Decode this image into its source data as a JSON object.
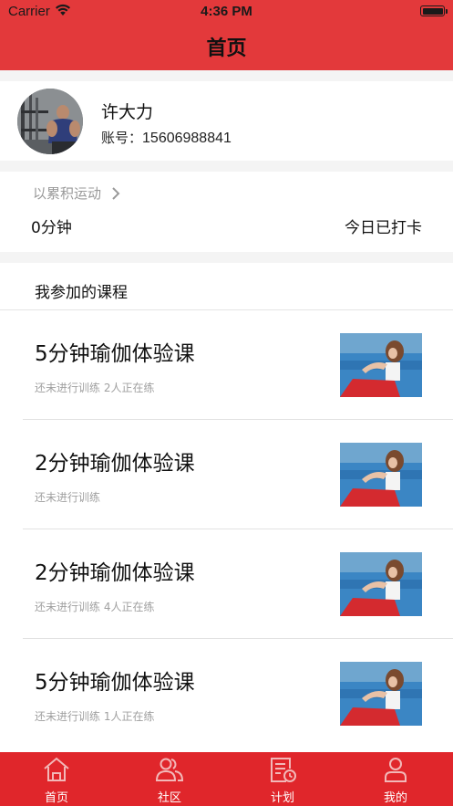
{
  "status_bar": {
    "carrier": "Carrier",
    "time": "4:36 PM"
  },
  "nav": {
    "title": "首页"
  },
  "profile": {
    "name": "许大力",
    "account_label": "账号：",
    "account_number": "15606988841"
  },
  "stats": {
    "link_label": "以累积运动",
    "minutes": "0分钟",
    "checkin": "今日已打卡"
  },
  "courses": {
    "section_title": "我参加的课程",
    "items": [
      {
        "title": "5分钟瑜伽体验课",
        "subtitle": "还未进行训练 2人正在练"
      },
      {
        "title": "2分钟瑜伽体验课",
        "subtitle": "还未进行训练"
      },
      {
        "title": "2分钟瑜伽体验课",
        "subtitle": "还未进行训练 4人正在练"
      },
      {
        "title": "5分钟瑜伽体验课",
        "subtitle": "还未进行训练 1人正在练"
      }
    ]
  },
  "tabbar": {
    "items": [
      {
        "label": "首页",
        "icon": "home-icon",
        "active": true
      },
      {
        "label": "社区",
        "icon": "community-icon",
        "active": false
      },
      {
        "label": "计划",
        "icon": "plan-icon",
        "active": false
      },
      {
        "label": "我的",
        "icon": "profile-icon",
        "active": false
      }
    ]
  },
  "colors": {
    "brand_red": "#e3393b",
    "tabbar_red": "#e0262b"
  }
}
